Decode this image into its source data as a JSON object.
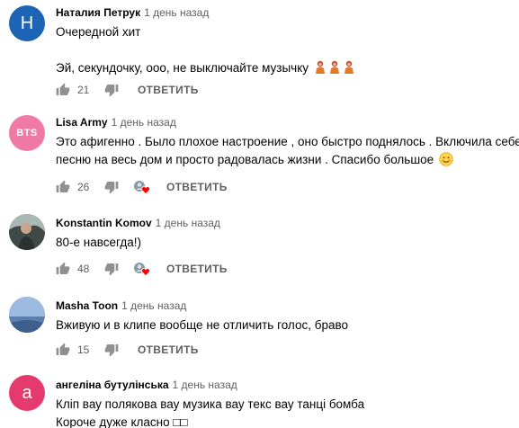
{
  "comments": [
    {
      "author": "Наталия Петрук",
      "time": "1 день назад",
      "avatar": {
        "type": "letter",
        "letter": "Н",
        "color": "#1e64b4"
      },
      "lines": [
        "Очередной хит",
        "",
        "Эй, секундочку, ооо, не выключайте музычку"
      ],
      "emojis": [
        "person-bowing-icon",
        "person-bowing-icon",
        "person-bowing-icon"
      ],
      "likes": "21",
      "creator_heart": false,
      "reply": "ОТВЕТИТЬ"
    },
    {
      "author": "Lisa Army",
      "time": "1 день назад",
      "avatar": {
        "type": "text",
        "text": "BTS",
        "color": "#f07aa4"
      },
      "lines": [
        "Это афигенно . Было плохое настроение , оно быстро поднялось . Включила себе",
        "песню на весь дом и просто радовалась жизни . Спасибо большое"
      ],
      "emojis": [
        "smiling-face-icon"
      ],
      "likes": "26",
      "creator_heart": true,
      "reply": "ОТВЕТИТЬ"
    },
    {
      "author": "Konstantin Komov",
      "time": "1 день назад",
      "avatar": {
        "type": "photo",
        "color": "#6d7a78"
      },
      "lines": [
        "80-е навсегда!)"
      ],
      "likes": "48",
      "creator_heart": true,
      "reply": "ОТВЕТИТЬ"
    },
    {
      "author": "Masha Toon",
      "time": "1 день назад",
      "avatar": {
        "type": "photo",
        "color": "#7fa3cc"
      },
      "lines": [
        "Вживую и в клипе вообще не отличить голос, браво"
      ],
      "likes": "15",
      "creator_heart": false,
      "reply": "ОТВЕТИТЬ"
    },
    {
      "author": "ангеліна бутулінська",
      "time": "1 день назад",
      "avatar": {
        "type": "letter",
        "letter": "а",
        "color": "#e53a6d"
      },
      "lines": [
        "Кліп вау полякова вау музика вау текс вау танці бомба",
        "Короче дуже класно □□"
      ]
    }
  ],
  "colors": {
    "text": "#030303",
    "secondary": "#606060",
    "heart": "#ff0000"
  }
}
